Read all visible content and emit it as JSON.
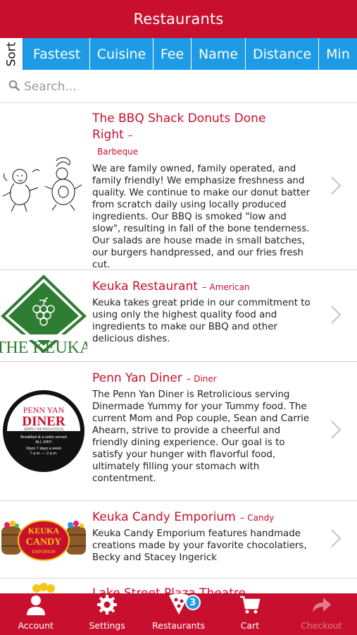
{
  "header": {
    "title": "Restaurants"
  },
  "sort": {
    "label": "Sort",
    "options": [
      "Fastest",
      "Cuisine",
      "Fee",
      "Name",
      "Distance",
      "Min"
    ]
  },
  "search": {
    "placeholder": "Search..."
  },
  "restaurants": [
    {
      "name": "The BBQ Shack Donuts Done Right",
      "cuisine": "Barbeque",
      "description": "We are family owned, family operated, and family friendly! We emphasize freshness and quality. We continue to make our donut batter from scratch daily using locally produced ingredients. Our BBQ is smoked \"low and slow\", resulting in fall of the bone tenderness. Our salads are house made in small batches, our burgers handpressed, and our fries fresh cut."
    },
    {
      "name": "Keuka Restaurant",
      "cuisine": "American",
      "description": "Keuka takes great pride in our commitment to using only the highest quality food and ingredients to make our BBQ and other delicious dishes.",
      "logo_text": "THE KEUKA"
    },
    {
      "name": "Penn Yan Diner",
      "cuisine": "Diner",
      "description": "The Penn Yan Diner is Retrolicious serving Dinermade Yummy for your Tummy food. The current Mom and Pop couple, Sean and Carrie Ahearn, strive to provide a cheerful and friendly dining experience. Our goal is to satisfy your hunger with flavorful food, ultimately filling your stomach with contentment.",
      "logo_text": [
        "PENN YAN",
        "DINER",
        "SIMPLY RETROLICIOUS",
        "Breakfast & a smile served",
        "ALL DAY!",
        "Open 7 days a week",
        "7 a.m. — 2 p.m."
      ]
    },
    {
      "name": "Keuka Candy Emporium",
      "cuisine": "Candy",
      "description": "Keuka Candy Emporium features handmade creations made by your favorite chocolatiers, Becky and Stacey Ingerick",
      "logo_text": [
        "KEUKA",
        "CANDY",
        "EMPORIUM"
      ]
    },
    {
      "name": "Lake Street Plaza Theatre",
      "cuisine": "",
      "description": ""
    }
  ],
  "tabs": [
    {
      "label": "Account",
      "icon": "person-icon"
    },
    {
      "label": "Settings",
      "icon": "gear-icon"
    },
    {
      "label": "Restaurants",
      "icon": "pizza-icon",
      "badge": "3"
    },
    {
      "label": "Cart",
      "icon": "cart-icon"
    },
    {
      "label": "Checkout",
      "icon": "checkout-arrow-icon",
      "disabled": true
    }
  ],
  "colors": {
    "primary_red": "#c8102e",
    "accent_blue": "#1e9be6"
  }
}
